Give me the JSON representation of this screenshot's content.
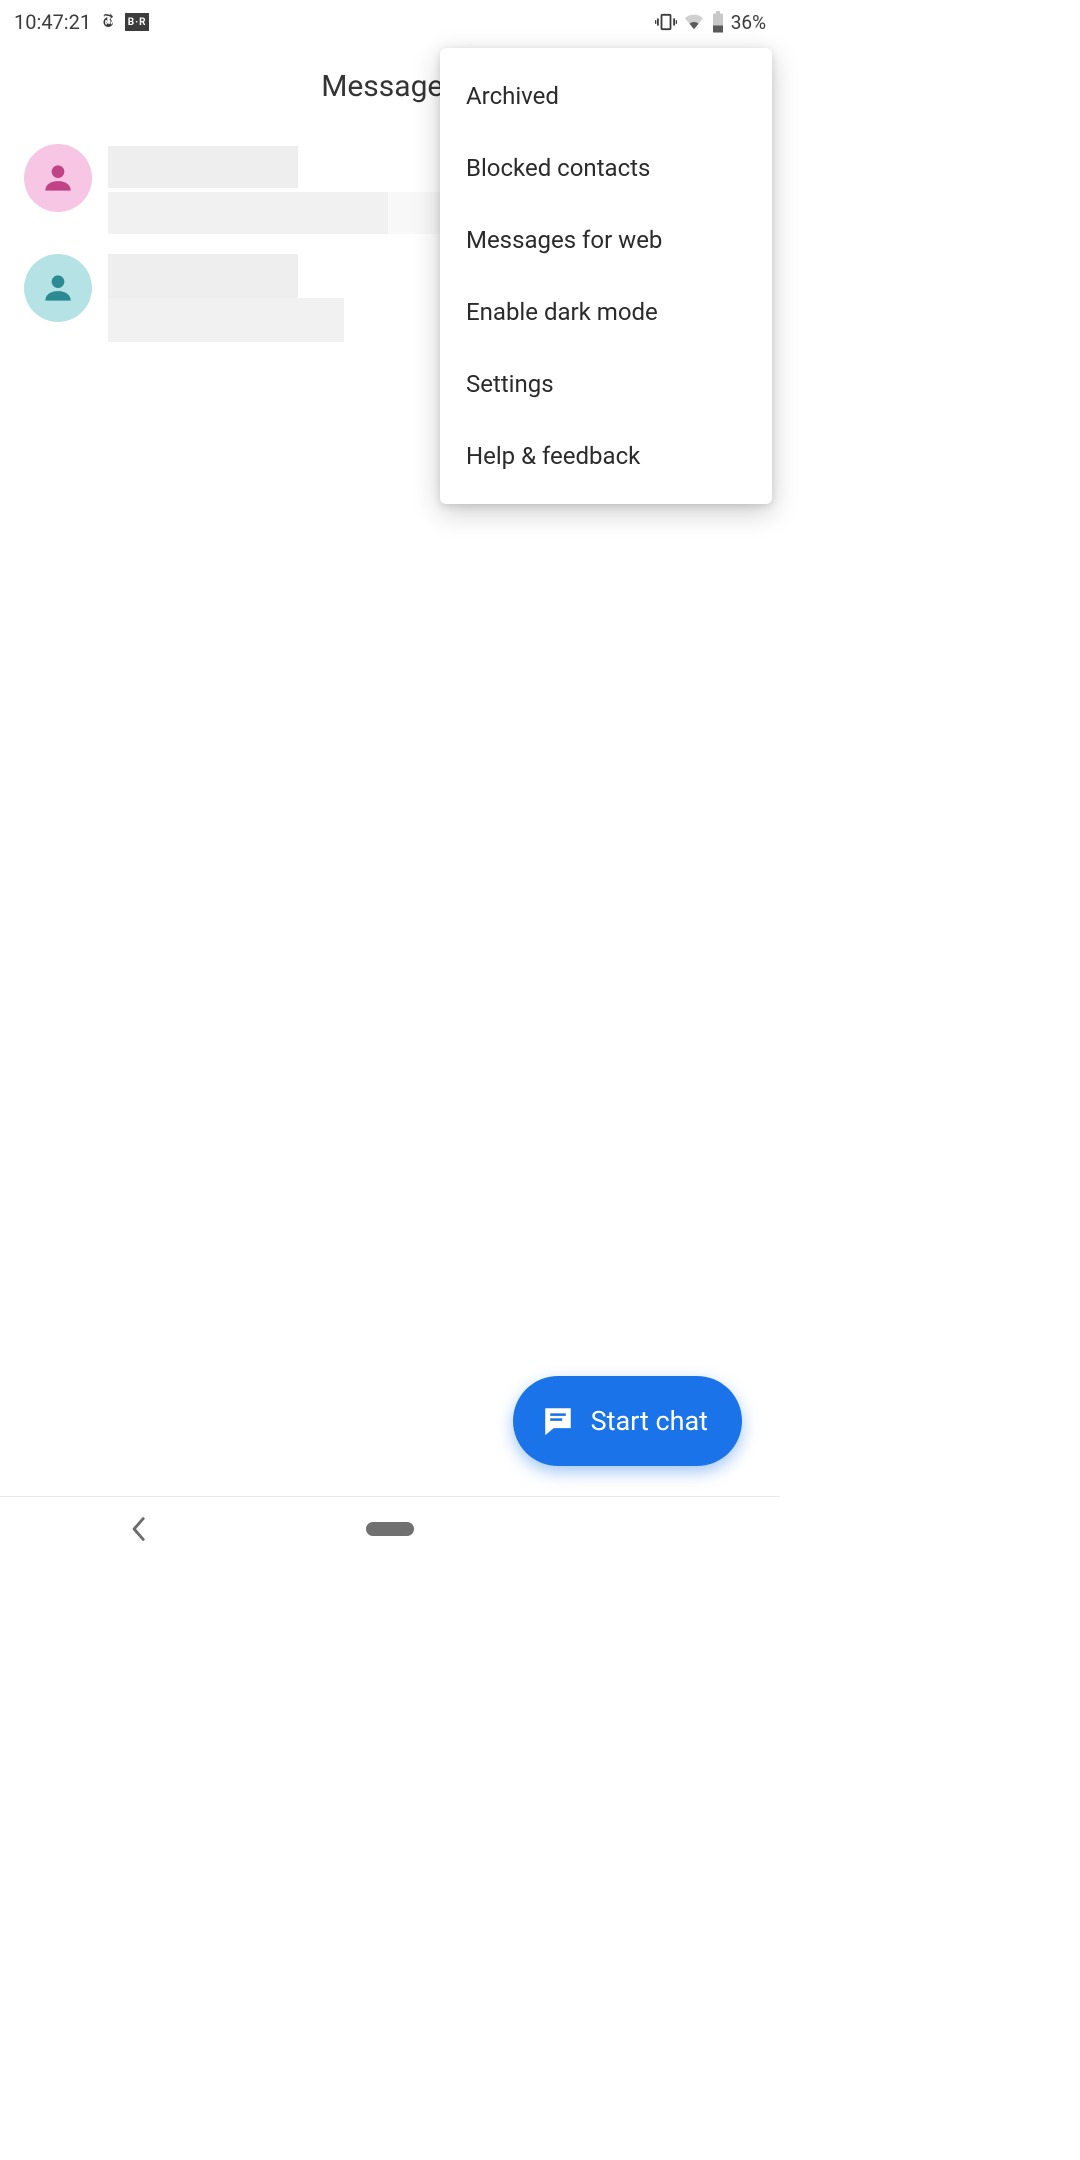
{
  "status_bar": {
    "time": "10:47:21",
    "app_icons": {
      "nyt": "nyt-icon",
      "br": "br-icon",
      "br_label": "B·R"
    },
    "battery_percent": "36%"
  },
  "app_bar": {
    "title": "Messages"
  },
  "conversations": [
    {
      "avatar_color": "pink"
    },
    {
      "avatar_color": "teal"
    }
  ],
  "overflow_menu": {
    "items": [
      {
        "label": "Archived"
      },
      {
        "label": "Blocked contacts"
      },
      {
        "label": "Messages for web"
      },
      {
        "label": "Enable dark mode"
      },
      {
        "label": "Settings"
      },
      {
        "label": "Help & feedback"
      }
    ]
  },
  "fab": {
    "label": "Start chat"
  },
  "colors": {
    "accent": "#1a73e8",
    "avatar_pink": "#f7c6e5",
    "avatar_pink_fg": "#c04386",
    "avatar_teal": "#b5e3e5",
    "avatar_teal_fg": "#2b8a92"
  }
}
